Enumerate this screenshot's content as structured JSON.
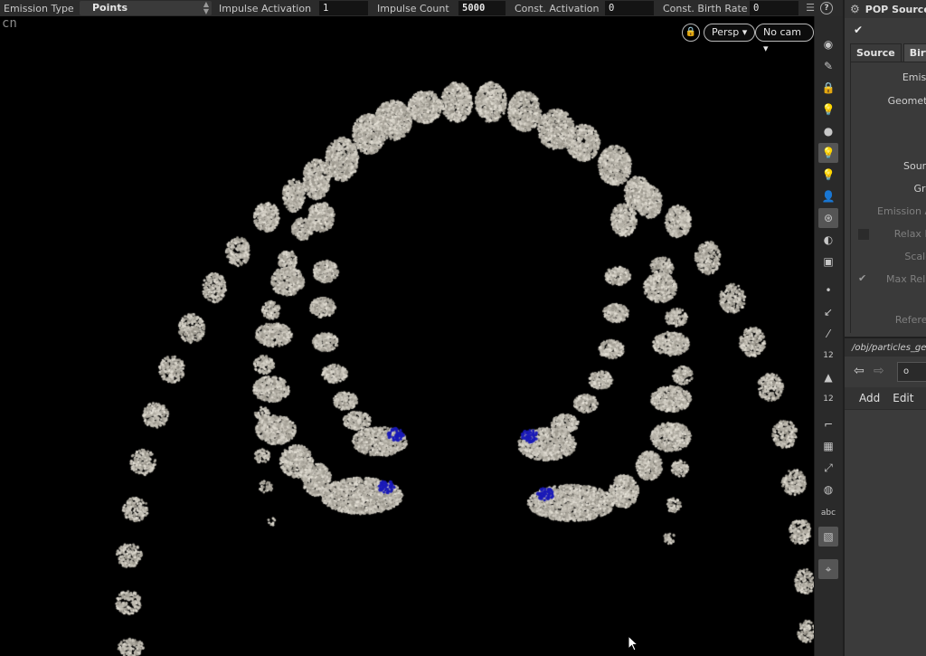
{
  "topbar": {
    "emission_type_label": "Emission Type",
    "emission_type_value": "Points",
    "impulse_activation_label": "Impulse Activation",
    "impulse_activation_value": "1",
    "impulse_count_label": "Impulse Count",
    "impulse_count_value": "5000",
    "const_activation_label": "Const. Activation",
    "const_activation_value": "0",
    "const_birth_rate_label": "Const. Birth Rate",
    "const_birth_rate_value": "0",
    "help_label": "?"
  },
  "viewport": {
    "corner_text": "cn",
    "persp_label": "Persp ▾",
    "cam_label": "No cam ▾",
    "particle_color": "#cfcac0",
    "highlight_color": "#1a1ab8"
  },
  "vtoolbar": {
    "icons": [
      "eye-icon",
      "edit-icon",
      "lock-icon",
      "light-icon",
      "sphere-icon",
      "bulb-icon",
      "bulb-add-icon",
      "bulb-user-icon",
      "camera-icon",
      "view-icon",
      "render-icon",
      "dot-icon",
      "pin-icon",
      "dropper-icon",
      "num12-icon",
      "paint-icon",
      "num12b-icon",
      "corner-icon",
      "grid-icon",
      "snap-icon",
      "stop-icon",
      "abc-icon",
      "image-icon",
      "marker-icon"
    ],
    "abc_label": "abc",
    "num_label": "12"
  },
  "panel": {
    "title": "POP Source",
    "tabs": [
      "Source",
      "Birth"
    ],
    "params": [
      "Emiss",
      "Geometr",
      "Sourc",
      "Gro",
      "Emission A",
      "Relax It",
      "Scale",
      "Max Rela",
      "Referer"
    ],
    "path": "/obj/particles_geo/",
    "node_label": "o",
    "menu_add": "Add",
    "menu_edit": "Edit"
  }
}
